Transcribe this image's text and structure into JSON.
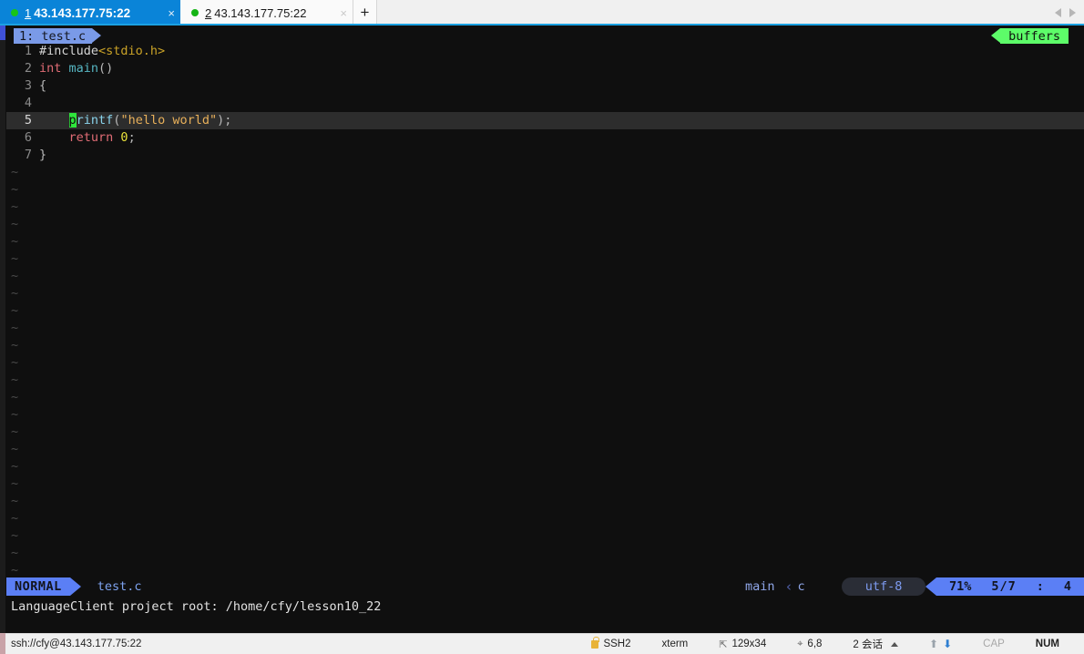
{
  "tabs": [
    {
      "num": "1",
      "label": "43.143.177.75:22",
      "active": true,
      "close": "×",
      "status_dot": "connected"
    },
    {
      "num": "2",
      "label": "43.143.177.75:22",
      "active": false,
      "close": "×",
      "status_dot": "connected"
    }
  ],
  "tabbar": {
    "add_label": "+",
    "nav_prev": "prev-tab",
    "nav_next": "next-tab"
  },
  "vim": {
    "tabline": {
      "buffer_tab": "1: test.c",
      "buffers_label": "buffers"
    },
    "lines": [
      {
        "num": "1",
        "tokens": [
          {
            "t": "#include",
            "c": "tok-pre"
          },
          {
            "t": "<stdio.h>",
            "c": "tok-inc"
          }
        ]
      },
      {
        "num": "2",
        "tokens": [
          {
            "t": "int ",
            "c": "tok-type"
          },
          {
            "t": "main",
            "c": "tok-func"
          },
          {
            "t": "()",
            "c": "tok-punc"
          }
        ]
      },
      {
        "num": "3",
        "tokens": [
          {
            "t": "{",
            "c": "tok-punc"
          }
        ]
      },
      {
        "num": "4",
        "tokens": []
      },
      {
        "num": "5",
        "current": true,
        "tokens": [
          {
            "t": "    ",
            "c": "tok-punc"
          },
          {
            "t": "p",
            "c": "cursor-blk"
          },
          {
            "t": "rintf",
            "c": "tok-call"
          },
          {
            "t": "(",
            "c": "tok-punc"
          },
          {
            "t": "\"hello world\"",
            "c": "tok-str"
          },
          {
            "t": ");",
            "c": "tok-punc"
          }
        ]
      },
      {
        "num": "6",
        "tokens": [
          {
            "t": "    ",
            "c": "tok-punc"
          },
          {
            "t": "return ",
            "c": "tok-kw"
          },
          {
            "t": "0",
            "c": "tok-num"
          },
          {
            "t": ";",
            "c": "tok-punc"
          }
        ]
      },
      {
        "num": "7",
        "tokens": [
          {
            "t": "}",
            "c": "tok-punc"
          }
        ]
      }
    ],
    "empty_marker": "~",
    "empty_rows": 24,
    "statusline": {
      "mode": "NORMAL",
      "filename": "test.c",
      "branch": "main",
      "separator": "‹",
      "filetype": "c",
      "encoding": "utf-8",
      "percent": "71%",
      "line_of_total": "5/7",
      "colon": ":",
      "column": "4"
    },
    "message": "LanguageClient project root: /home/cfy/lesson10_22"
  },
  "appstatus": {
    "connection": "ssh://cfy@43.143.177.75:22",
    "protocol": "SSH2",
    "term_type": "xterm",
    "size": "129x34",
    "cursor_pos": "6,8",
    "sessions": "2 会话",
    "cap": "CAP",
    "num": "NUM",
    "upload_icon": "upload-arrow",
    "download_icon": "download-arrow"
  },
  "colors": {
    "tab_active_bg": "#0a84d8",
    "accent_blue": "#5b7ff5",
    "buffers_green": "#5dfc69",
    "cursor_green": "#2ee63c",
    "terminal_bg": "#0f0f0f"
  }
}
